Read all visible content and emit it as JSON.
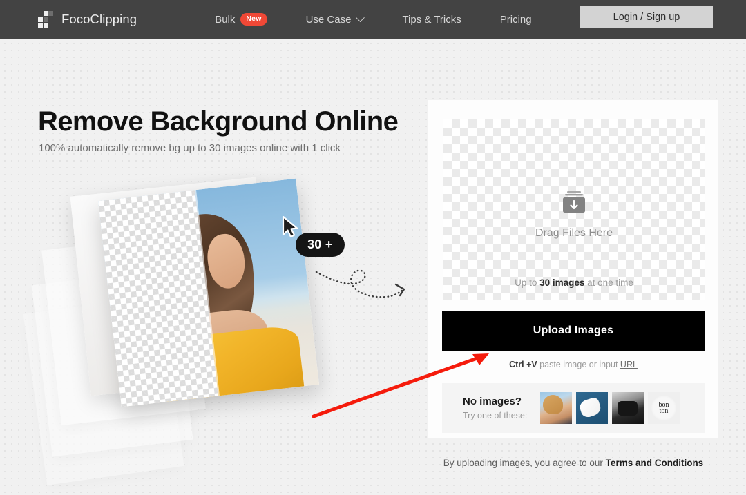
{
  "navbar": {
    "brand": "FocoClipping",
    "logo_icon": "pixel-blocks-logo-icon",
    "links": [
      {
        "label": "Bulk",
        "badge": "New"
      },
      {
        "label": "Use Case",
        "caret": "chevron-down-icon"
      },
      {
        "label": "Tips & Tricks"
      },
      {
        "label": "Pricing"
      }
    ],
    "login_label": "Login / Sign up",
    "bg_color": "#434343",
    "badge_color": "#f04836"
  },
  "hero": {
    "title": "Remove Background Online",
    "subtitle": "100% automatically remove bg up to 30 images online with 1 click",
    "count_badge": "30 +",
    "cursor_icon": "mouse-pointer-icon",
    "curly_arrow_icon": "dotted-curved-arrow-icon"
  },
  "upload_panel": {
    "dropzone": {
      "icon": "tray-download-icon",
      "label": "Drag Files Here",
      "limit_prefix": "Up to ",
      "limit_strong": "30 images",
      "limit_suffix": " at one time"
    },
    "upload_button": "Upload Images",
    "paste_hint": {
      "shortcut": "Ctrl +V",
      "text": " paste image or input ",
      "link": "URL"
    },
    "samples": {
      "title": "No images?",
      "subtitle": "Try one of these:",
      "thumbnails": [
        "woman-with-sunglasses-thumbnail",
        "white-sneakers-thumbnail",
        "black-camera-thumbnail",
        "bon-ton-logo-thumbnail"
      ],
      "thumb4_line1": "bon",
      "thumb4_line2": "ton"
    }
  },
  "footer": {
    "terms_prefix": "By uploading images, you agree to our ",
    "terms_link": "Terms and Conditions"
  },
  "annotation": {
    "arrow_color": "#f51b0c",
    "target": "upload-images-button"
  }
}
